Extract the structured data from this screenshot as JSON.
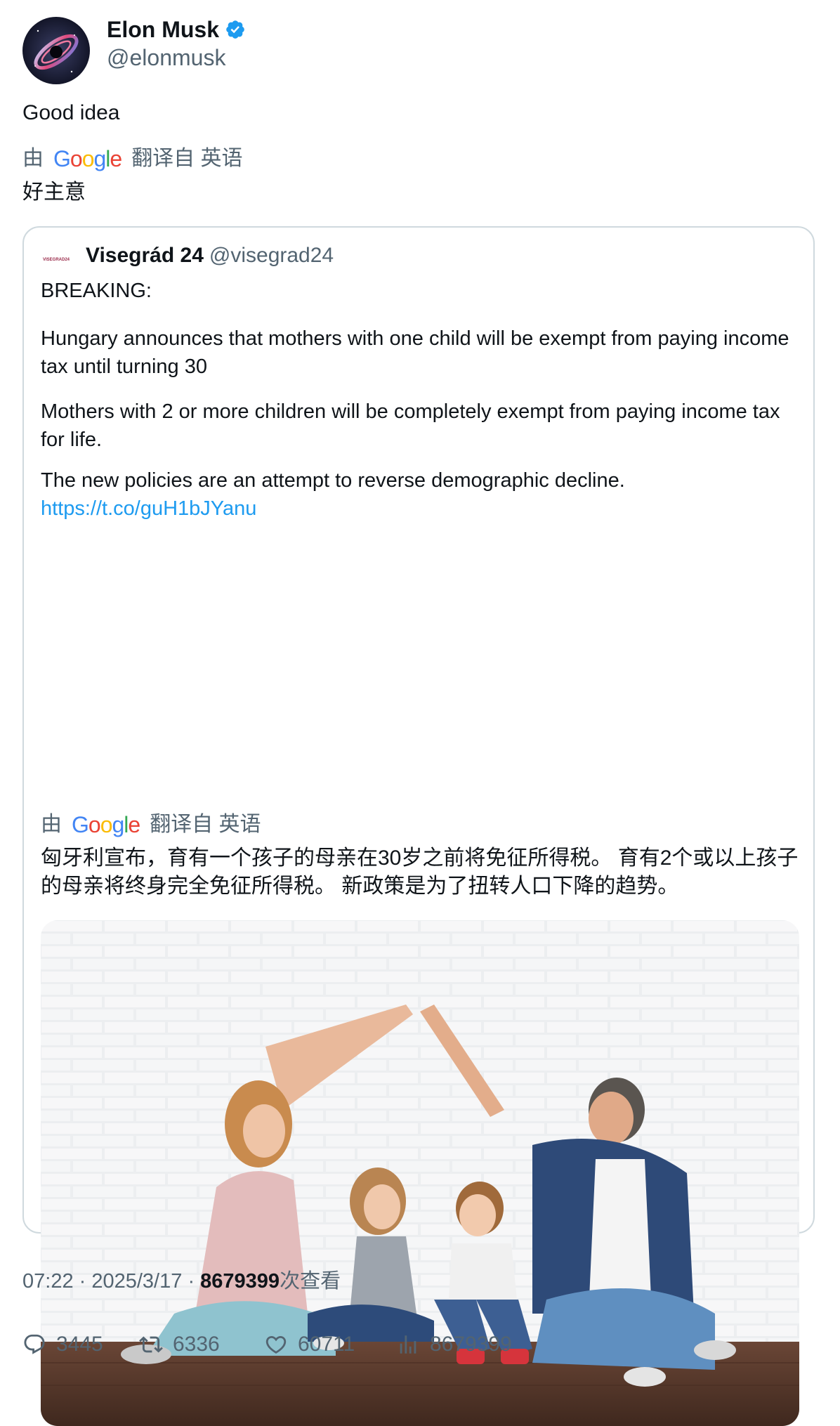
{
  "author": {
    "name": "Elon Musk",
    "handle": "@elonmusk",
    "verified": true
  },
  "tweet": {
    "text": "Good idea",
    "translated_by_prefix": "由",
    "translated_by_suffix": "翻译自 英语",
    "translation": "好主意"
  },
  "quote": {
    "avatar_label": "VISEGRAD24",
    "name": "Visegrád 24",
    "handle": "@visegrad24",
    "paragraphs": [
      "BREAKING:",
      "Hungary announces that mothers with one child will be exempt from paying income tax until turning 30",
      "Mothers with 2 or more children will be completely exempt from paying income tax for life.",
      "The new policies are an attempt to reverse demographic decline."
    ],
    "link": "https://t.co/guH1bJYanu",
    "translated_by_prefix": "由",
    "translated_by_suffix": "翻译自 英语",
    "translation": "匈牙利宣布，育有一个孩子的母亲在30岁之前将免征所得税。 育有2个或以上孩子的母亲将终身完全免征所得税。 新政策是为了扭转人口下降的趋势。"
  },
  "meta": {
    "time": "07:22",
    "date": "2025/3/17",
    "views_count": "8679399",
    "views_label": "次查看"
  },
  "actions": {
    "replies": "3445",
    "retweets": "6336",
    "likes": "60711",
    "views": "8679399"
  },
  "colors": {
    "text": "#0f1419",
    "secondary": "#536471",
    "link": "#1d9bf0",
    "verified": "#1d9bf0",
    "border": "#cfd9de"
  }
}
